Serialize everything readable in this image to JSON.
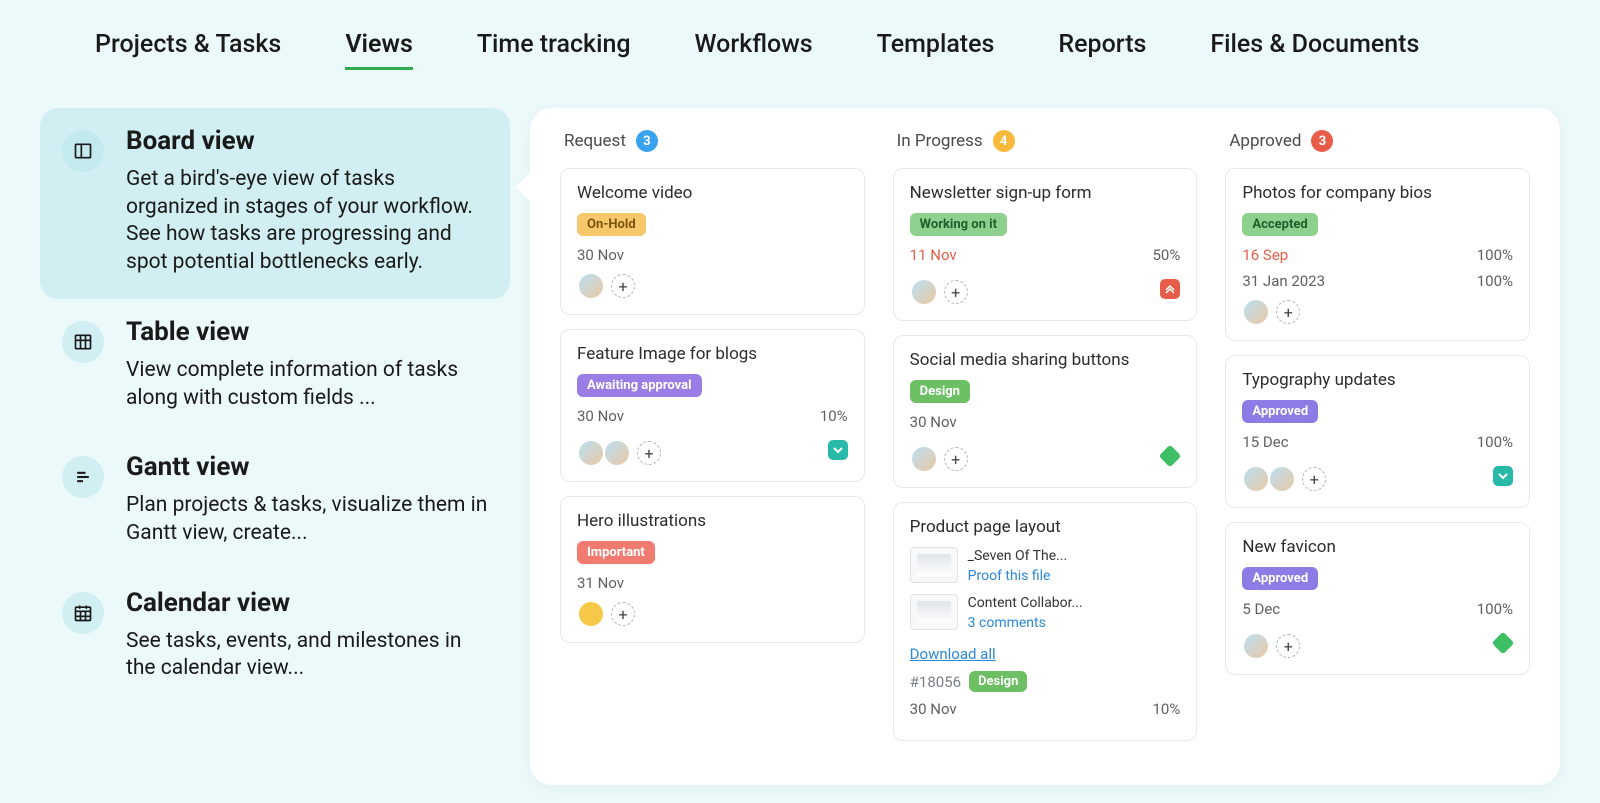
{
  "tabs": [
    "Projects & Tasks",
    "Views",
    "Time tracking",
    "Workflows",
    "Templates",
    "Reports",
    "Files & Documents"
  ],
  "active_tab": 1,
  "sidebar": [
    {
      "title": "Board view",
      "desc": "Get a bird's-eye view of tasks organized in stages of your workflow. See how tasks are progressing and spot potential bottlenecks early."
    },
    {
      "title": "Table view",
      "desc": "View complete information of tasks along with custom fields ..."
    },
    {
      "title": "Gantt view",
      "desc": "Plan projects & tasks, visualize them in Gantt view, create..."
    },
    {
      "title": "Calendar view",
      "desc": "See tasks, events, and milestones in the calendar view..."
    }
  ],
  "columns": [
    {
      "name": "Request",
      "count": 3,
      "badge": "cb-blue",
      "cards": [
        {
          "title": "Welcome video",
          "status": "On-Hold",
          "status_cls": "st-onhold",
          "date": "30 Nov",
          "avatars": 1
        },
        {
          "title": "Feature Image for blogs",
          "status": "Awaiting approval",
          "status_cls": "st-awaiting",
          "date": "30 Nov",
          "pct": "10%",
          "avatars": 2,
          "priority": "teal-down"
        },
        {
          "title": "Hero illustrations",
          "status": "Important",
          "status_cls": "st-important",
          "date": "31 Nov",
          "avatars": 1,
          "avatar_cls": "yellow"
        }
      ]
    },
    {
      "name": "In Progress",
      "count": 4,
      "badge": "cb-yellow",
      "cards": [
        {
          "title": "Newsletter sign-up form",
          "status": "Working on it",
          "status_cls": "st-working",
          "date": "11 Nov",
          "date_red": true,
          "pct": "50%",
          "avatars": 1,
          "priority": "red-up"
        },
        {
          "title": "Social media sharing buttons",
          "status": "Design",
          "status_cls": "st-design",
          "date": "30 Nov",
          "avatars": 1,
          "priority": "green-diamond"
        },
        {
          "title": "Product page layout",
          "attachments": [
            {
              "name": "_Seven Of The...",
              "link": "Proof this file"
            },
            {
              "name": "Content Collabor...",
              "link": "3 comments"
            }
          ],
          "download": "Download all",
          "task_id": "#18056",
          "id_status": "Design",
          "id_status_cls": "st-design",
          "date": "30 Nov",
          "pct": "10%"
        }
      ]
    },
    {
      "name": "Approved",
      "count": 3,
      "badge": "cb-red",
      "cards": [
        {
          "title": "Photos for company bios",
          "status": "Accepted",
          "status_cls": "st-accepted",
          "date": "16 Sep",
          "date_red": true,
          "date2": "31 Jan 2023",
          "pct": "100%",
          "avatars": 1
        },
        {
          "title": "Typography updates",
          "status": "Approved",
          "status_cls": "st-approved",
          "date": "15 Dec",
          "pct": "100%",
          "avatars": 2,
          "priority": "teal-down"
        },
        {
          "title": "New favicon",
          "status": "Approved",
          "status_cls": "st-approved",
          "date": "5 Dec",
          "pct": "100%",
          "avatars": 1,
          "priority": "green-diamond"
        }
      ]
    }
  ]
}
